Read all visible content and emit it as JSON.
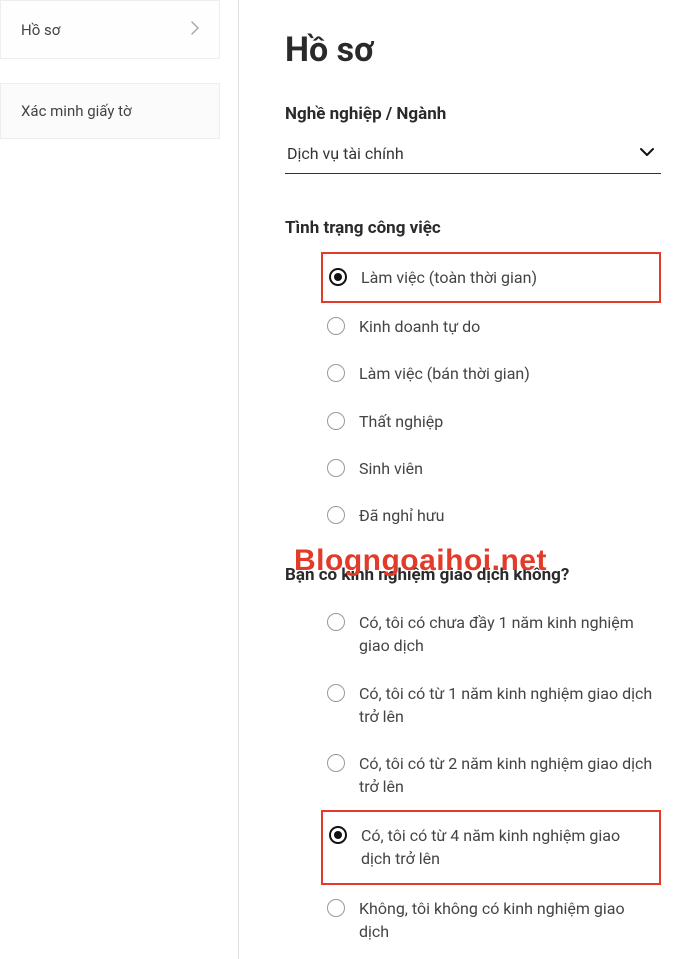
{
  "sidebar": {
    "items": [
      {
        "label": "Hồ sơ",
        "active": true,
        "chevron": true
      },
      {
        "label": "Xác minh giấy tờ",
        "active": false,
        "chevron": false
      }
    ]
  },
  "main": {
    "title": "Hồ sơ",
    "occupation": {
      "label": "Nghề nghiệp / Ngành",
      "value": "Dịch vụ tài chính"
    },
    "employment": {
      "label": "Tình trạng công việc",
      "options": [
        "Làm việc (toàn thời gian)",
        "Kinh doanh tự do",
        "Làm việc (bán thời gian)",
        "Thất nghiệp",
        "Sinh viên",
        "Đã nghỉ hưu"
      ],
      "selected_index": 0
    },
    "experience": {
      "label": "Bạn có kinh nghiệm giao dịch không?",
      "options": [
        "Có, tôi có chưa đầy 1 năm kinh nghiệm giao dịch",
        "Có, tôi có từ 1 năm kinh nghiệm giao dịch trở lên",
        "Có, tôi có từ 2 năm kinh nghiệm giao dịch trở lên",
        "Có, tôi có từ 4 năm kinh nghiệm giao dịch trở lên",
        "Không, tôi không có kinh nghiệm giao dịch"
      ],
      "selected_index": 3
    }
  },
  "watermark": "Blogngoaihoi.net"
}
